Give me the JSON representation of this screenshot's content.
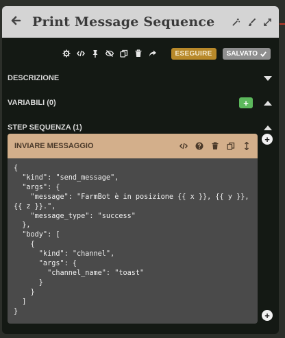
{
  "header": {
    "title": "Print Message Sequence"
  },
  "toolbar": {
    "run_label": "ESEGUIRE",
    "saved_label": "SALVATO"
  },
  "sections": {
    "description": "DESCRIZIONE",
    "variables": "VARIABILI (0)",
    "steps": "STEP SEQUENZA (1)"
  },
  "step": {
    "title": "INVIARE MESSAGGIO",
    "code_lines": [
      "{",
      "  \"kind\": \"send_message\",",
      "  \"args\": {",
      "    \"message\": \"FarmBot è in posizione {{ x }}, {{ y }},",
      "{{ z }}.\",",
      "    \"message_type\": \"success\"",
      "  },",
      "  \"body\": [",
      "    {",
      "      \"kind\": \"channel\",",
      "      \"args\": {",
      "        \"channel_name\": \"toast\"",
      "      }",
      "    }",
      "  ]",
      "}"
    ]
  },
  "colors": {
    "header_bg": "#d4d4d4",
    "panel_bg": "#141914",
    "run_button": "#b8892a",
    "saved_button": "#8f8f8f",
    "add_green": "#5cb85c",
    "step_header": "#d3af8b",
    "step_body": "#4a4a4a"
  },
  "icons": {
    "back": "arrow-left-icon",
    "header": [
      "magic-wand-icon",
      "paint-brush-icon",
      "expand-icon"
    ],
    "toolbar": [
      "gear-icon",
      "code-icon",
      "pin-icon",
      "eye-slash-icon",
      "copy-icon",
      "trash-icon",
      "share-icon"
    ],
    "step": [
      "code-icon",
      "help-icon",
      "trash-icon",
      "copy-icon",
      "drag-icon"
    ]
  }
}
